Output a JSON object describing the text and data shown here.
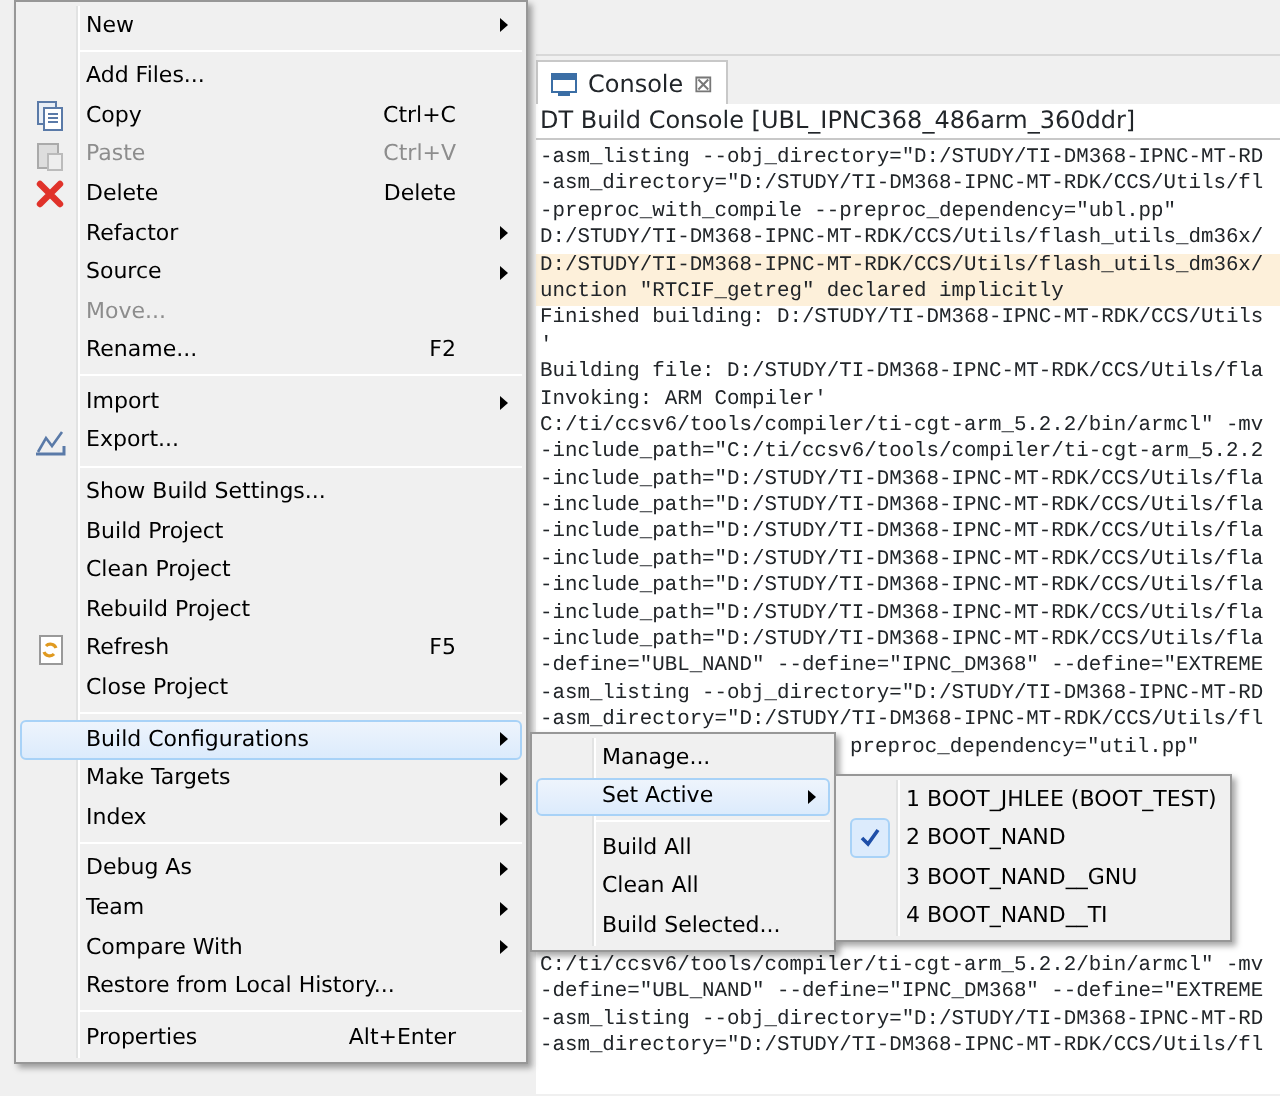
{
  "console": {
    "tab": {
      "label": "Console",
      "close": "⊠"
    },
    "header": "DT Build Console [UBL_IPNC368_486arm_360ddr]",
    "lines_above": [
      {
        "text": "-asm_listing --obj_directory=\"D:/STUDY/TI-DM368-IPNC-MT-RD",
        "highlighted": false
      },
      {
        "text": "-asm_directory=\"D:/STUDY/TI-DM368-IPNC-MT-RDK/CCS/Utils/fl",
        "highlighted": false
      },
      {
        "text": "-preproc_with_compile --preproc_dependency=\"ubl.pp\"",
        "highlighted": false
      },
      {
        "text": "D:/STUDY/TI-DM368-IPNC-MT-RDK/CCS/Utils/flash_utils_dm36x/",
        "highlighted": false
      },
      {
        "text": "D:/STUDY/TI-DM368-IPNC-MT-RDK/CCS/Utils/flash_utils_dm36x/",
        "highlighted": true
      },
      {
        "text": "unction \"RTCIF_getreg\" declared implicitly",
        "highlighted": true
      },
      {
        "text": "Finished building: D:/STUDY/TI-DM368-IPNC-MT-RDK/CCS/Utils",
        "highlighted": false
      },
      {
        "text": "'",
        "highlighted": false
      },
      {
        "text": "Building file: D:/STUDY/TI-DM368-IPNC-MT-RDK/CCS/Utils/fla",
        "highlighted": false
      },
      {
        "text": "Invoking: ARM Compiler'",
        "highlighted": false
      },
      {
        "text": "C:/ti/ccsv6/tools/compiler/ti-cgt-arm_5.2.2/bin/armcl\" -mv",
        "highlighted": false
      },
      {
        "text": "-include_path=\"C:/ti/ccsv6/tools/compiler/ti-cgt-arm_5.2.2",
        "highlighted": false
      },
      {
        "text": "-include_path=\"D:/STUDY/TI-DM368-IPNC-MT-RDK/CCS/Utils/fla",
        "highlighted": false
      },
      {
        "text": "-include_path=\"D:/STUDY/TI-DM368-IPNC-MT-RDK/CCS/Utils/fla",
        "highlighted": false
      },
      {
        "text": "-include_path=\"D:/STUDY/TI-DM368-IPNC-MT-RDK/CCS/Utils/fla",
        "highlighted": false
      },
      {
        "text": "-include_path=\"D:/STUDY/TI-DM368-IPNC-MT-RDK/CCS/Utils/fla",
        "highlighted": false
      },
      {
        "text": "-include_path=\"D:/STUDY/TI-DM368-IPNC-MT-RDK/CCS/Utils/fla",
        "highlighted": false
      },
      {
        "text": "-include_path=\"D:/STUDY/TI-DM368-IPNC-MT-RDK/CCS/Utils/fla",
        "highlighted": false
      },
      {
        "text": "-include_path=\"D:/STUDY/TI-DM368-IPNC-MT-RDK/CCS/Utils/fla",
        "highlighted": false
      },
      {
        "text": "-define=\"UBL_NAND\" --define=\"IPNC_DM368\" --define=\"EXTREME",
        "highlighted": false
      },
      {
        "text": "-asm_listing --obj_directory=\"D:/STUDY/TI-DM368-IPNC-MT-RD",
        "highlighted": false
      },
      {
        "text": "-asm_directory=\"D:/STUDY/TI-DM368-IPNC-MT-RDK/CCS/Utils/fl",
        "highlighted": false
      }
    ],
    "line_tail": "preproc_dependency=\"util.pp\"",
    "lines_below": [
      {
        "text": "C:/ti/ccsv6/tools/compiler/ti-cgt-arm_5.2.2/bin/armcl\" -mv",
        "highlighted": false
      },
      {
        "text": "-define=\"UBL_NAND\" --define=\"IPNC_DM368\" --define=\"EXTREME",
        "highlighted": false
      },
      {
        "text": "-asm_listing --obj_directory=\"D:/STUDY/TI-DM368-IPNC-MT-RD",
        "highlighted": false
      },
      {
        "text": "-asm_directory=\"D:/STUDY/TI-DM368-IPNC-MT-RDK/CCS/Utils/fl",
        "highlighted": false
      }
    ]
  },
  "context_menu": {
    "items": [
      {
        "kind": "item",
        "label": "New",
        "submenu": true,
        "disabled": false,
        "selected": false
      },
      {
        "kind": "separator"
      },
      {
        "kind": "item",
        "label": "Add Files...",
        "submenu": false,
        "disabled": false,
        "selected": false
      },
      {
        "kind": "item",
        "label": "Copy",
        "shortcut": "Ctrl+C",
        "submenu": false,
        "disabled": false,
        "selected": false
      },
      {
        "kind": "item",
        "label": "Paste",
        "shortcut": "Ctrl+V",
        "submenu": false,
        "disabled": true,
        "selected": false
      },
      {
        "kind": "item",
        "label": "Delete",
        "shortcut": "Delete",
        "submenu": false,
        "disabled": false,
        "selected": false
      },
      {
        "kind": "item",
        "label": "Refactor",
        "submenu": true,
        "disabled": false,
        "selected": false
      },
      {
        "kind": "item",
        "label": "Source",
        "submenu": true,
        "disabled": false,
        "selected": false
      },
      {
        "kind": "item",
        "label": "Move...",
        "submenu": false,
        "disabled": true,
        "selected": false
      },
      {
        "kind": "item",
        "label": "Rename...",
        "shortcut": "F2",
        "submenu": false,
        "disabled": false,
        "selected": false
      },
      {
        "kind": "separator"
      },
      {
        "kind": "item",
        "label": "Import",
        "submenu": true,
        "disabled": false,
        "selected": false
      },
      {
        "kind": "item",
        "label": "Export...",
        "submenu": false,
        "disabled": false,
        "selected": false
      },
      {
        "kind": "separator"
      },
      {
        "kind": "item",
        "label": "Show Build Settings...",
        "submenu": false,
        "disabled": false,
        "selected": false
      },
      {
        "kind": "item",
        "label": "Build Project",
        "submenu": false,
        "disabled": false,
        "selected": false
      },
      {
        "kind": "item",
        "label": "Clean Project",
        "submenu": false,
        "disabled": false,
        "selected": false
      },
      {
        "kind": "item",
        "label": "Rebuild Project",
        "submenu": false,
        "disabled": false,
        "selected": false
      },
      {
        "kind": "item",
        "label": "Refresh",
        "shortcut": "F5",
        "submenu": false,
        "disabled": false,
        "selected": false
      },
      {
        "kind": "item",
        "label": "Close Project",
        "submenu": false,
        "disabled": false,
        "selected": false
      },
      {
        "kind": "separator"
      },
      {
        "kind": "item",
        "label": "Build Configurations",
        "submenu": true,
        "disabled": false,
        "selected": true
      },
      {
        "kind": "item",
        "label": "Make Targets",
        "submenu": true,
        "disabled": false,
        "selected": false
      },
      {
        "kind": "item",
        "label": "Index",
        "submenu": true,
        "disabled": false,
        "selected": false
      },
      {
        "kind": "separator"
      },
      {
        "kind": "item",
        "label": "Debug As",
        "submenu": true,
        "disabled": false,
        "selected": false
      },
      {
        "kind": "item",
        "label": "Team",
        "submenu": true,
        "disabled": false,
        "selected": false
      },
      {
        "kind": "item",
        "label": "Compare With",
        "submenu": true,
        "disabled": false,
        "selected": false
      },
      {
        "kind": "item",
        "label": "Restore from Local History...",
        "submenu": false,
        "disabled": false,
        "selected": false
      },
      {
        "kind": "separator"
      },
      {
        "kind": "item",
        "label": "Properties",
        "shortcut": "Alt+Enter",
        "submenu": false,
        "disabled": false,
        "selected": false
      }
    ]
  },
  "build_configurations_menu": {
    "items": [
      {
        "kind": "item",
        "label": "Manage...",
        "submenu": false,
        "disabled": false,
        "selected": false
      },
      {
        "kind": "item",
        "label": "Set Active",
        "submenu": true,
        "disabled": false,
        "selected": true
      },
      {
        "kind": "separator"
      },
      {
        "kind": "item",
        "label": "Build All",
        "submenu": false,
        "disabled": false,
        "selected": false
      },
      {
        "kind": "item",
        "label": "Clean All",
        "submenu": false,
        "disabled": false,
        "selected": false
      },
      {
        "kind": "item",
        "label": "Build Selected...",
        "submenu": false,
        "disabled": false,
        "selected": false
      }
    ]
  },
  "set_active_menu": {
    "items": [
      {
        "kind": "item",
        "label": "1 BOOT_JHLEE (BOOT_TEST)",
        "checked": false
      },
      {
        "kind": "item",
        "label": "2 BOOT_NAND",
        "checked": true
      },
      {
        "kind": "item",
        "label": "3 BOOT_NAND__GNU",
        "checked": false
      },
      {
        "kind": "item",
        "label": "4 BOOT_NAND__TI",
        "checked": false
      }
    ]
  }
}
